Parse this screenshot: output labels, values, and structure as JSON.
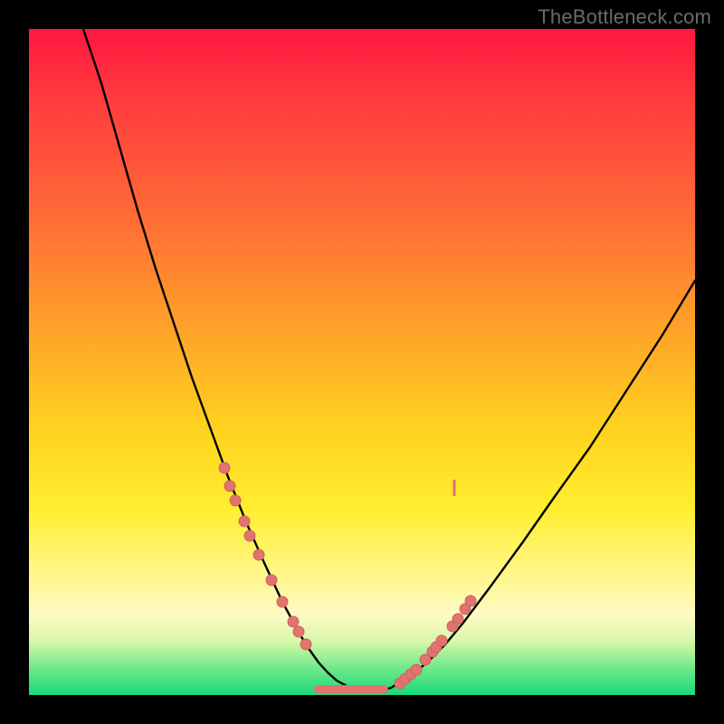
{
  "watermark": "TheBottleneck.com",
  "chart_data": {
    "type": "line",
    "title": "",
    "xlabel": "",
    "ylabel": "",
    "xlim": [
      0,
      736
    ],
    "ylim": [
      0,
      736
    ],
    "series": [
      {
        "name": "bottleneck-curve",
        "x": [
          60,
          80,
          100,
          120,
          140,
          160,
          180,
          200,
          220,
          240,
          260,
          280,
          300,
          310,
          320,
          330,
          340,
          355,
          370,
          385,
          400,
          420,
          440,
          460,
          480,
          510,
          545,
          580,
          620,
          660,
          700,
          736
        ],
        "y": [
          0,
          60,
          130,
          200,
          265,
          325,
          385,
          440,
          495,
          545,
          590,
          633,
          670,
          686,
          700,
          711,
          720,
          728,
          732,
          732,
          728,
          716,
          700,
          680,
          656,
          616,
          568,
          518,
          462,
          400,
          338,
          278
        ]
      }
    ],
    "markers_left": [
      [
        216,
        485
      ],
      [
        222,
        505
      ],
      [
        228,
        521
      ],
      [
        238,
        544
      ],
      [
        244,
        560
      ],
      [
        254,
        581
      ],
      [
        268,
        609
      ],
      [
        280,
        633
      ],
      [
        292,
        655
      ],
      [
        298,
        666
      ],
      [
        306,
        680
      ]
    ],
    "markers_right": [
      [
        410,
        723
      ],
      [
        416,
        718
      ],
      [
        422,
        713
      ],
      [
        428,
        708
      ],
      [
        438,
        697
      ],
      [
        446,
        688
      ],
      [
        450,
        683
      ],
      [
        456,
        676
      ],
      [
        468,
        660
      ],
      [
        474,
        652
      ],
      [
        482,
        641
      ],
      [
        488,
        632
      ]
    ],
    "flat_bottom": {
      "x1": 320,
      "x2": 392,
      "y": 730
    },
    "right_tick": {
      "x": 470,
      "y1": 498,
      "y2": 516
    }
  }
}
